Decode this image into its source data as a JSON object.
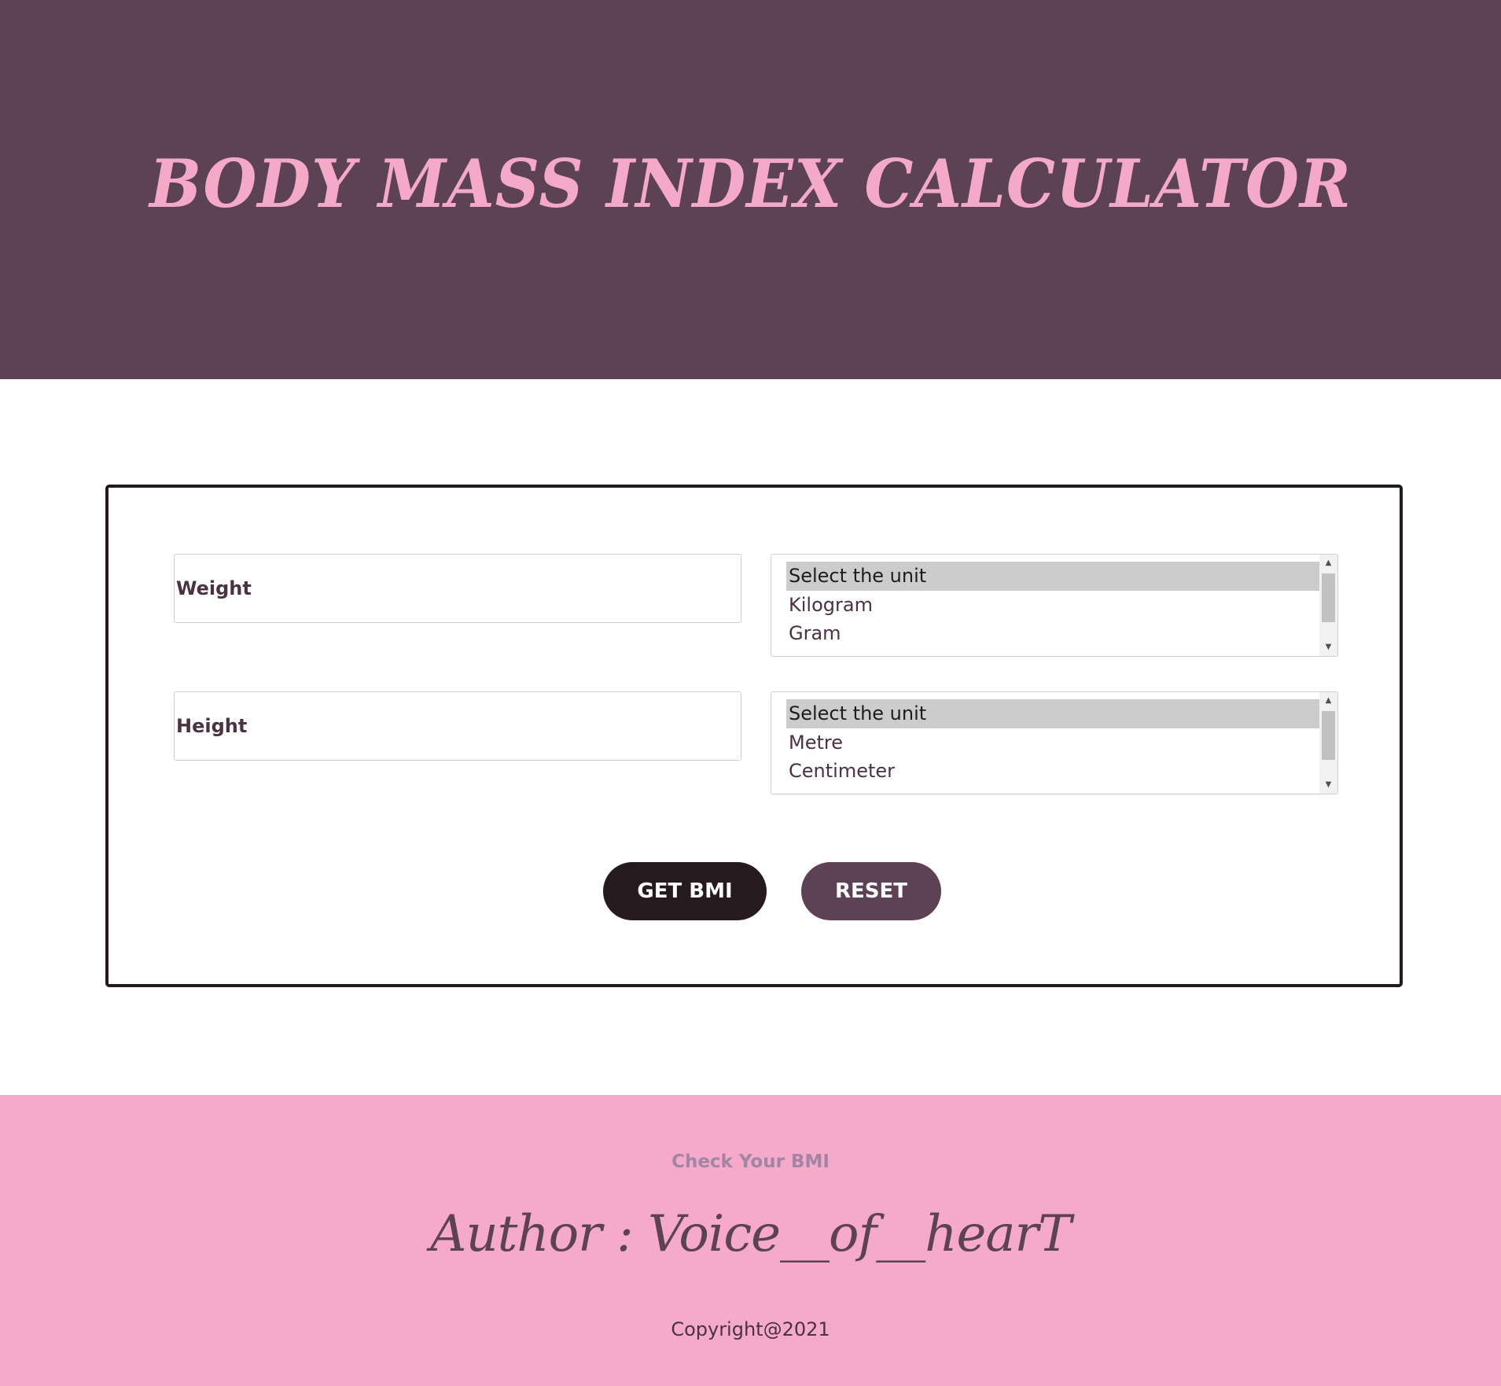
{
  "header": {
    "title": "BODY MASS INDEX CALCULATOR"
  },
  "form": {
    "weight": {
      "placeholder": "Weight",
      "unit_options": [
        "Select the unit",
        "Kilogram",
        "Gram"
      ],
      "selected_unit": "Select the unit"
    },
    "height": {
      "placeholder": "Height",
      "unit_options": [
        "Select the unit",
        "Metre",
        "Centimeter"
      ],
      "selected_unit": "Select the unit"
    }
  },
  "buttons": {
    "get_bmi": "GET BMI",
    "reset": "RESET"
  },
  "footer": {
    "tagline": "Check Your BMI",
    "author": "Author : Voice__of__hearT",
    "copyright": "Copyright@2021"
  },
  "colors": {
    "header_bg": "#5c4254",
    "title_pink": "#f5a9c8",
    "footer_bg": "#f5aac9",
    "get_bmi_bg": "#261a1e",
    "reset_bg": "#5c4254"
  },
  "icons": {
    "scroll_up": "scroll-up-arrow-icon",
    "scroll_down": "scroll-down-arrow-icon"
  }
}
